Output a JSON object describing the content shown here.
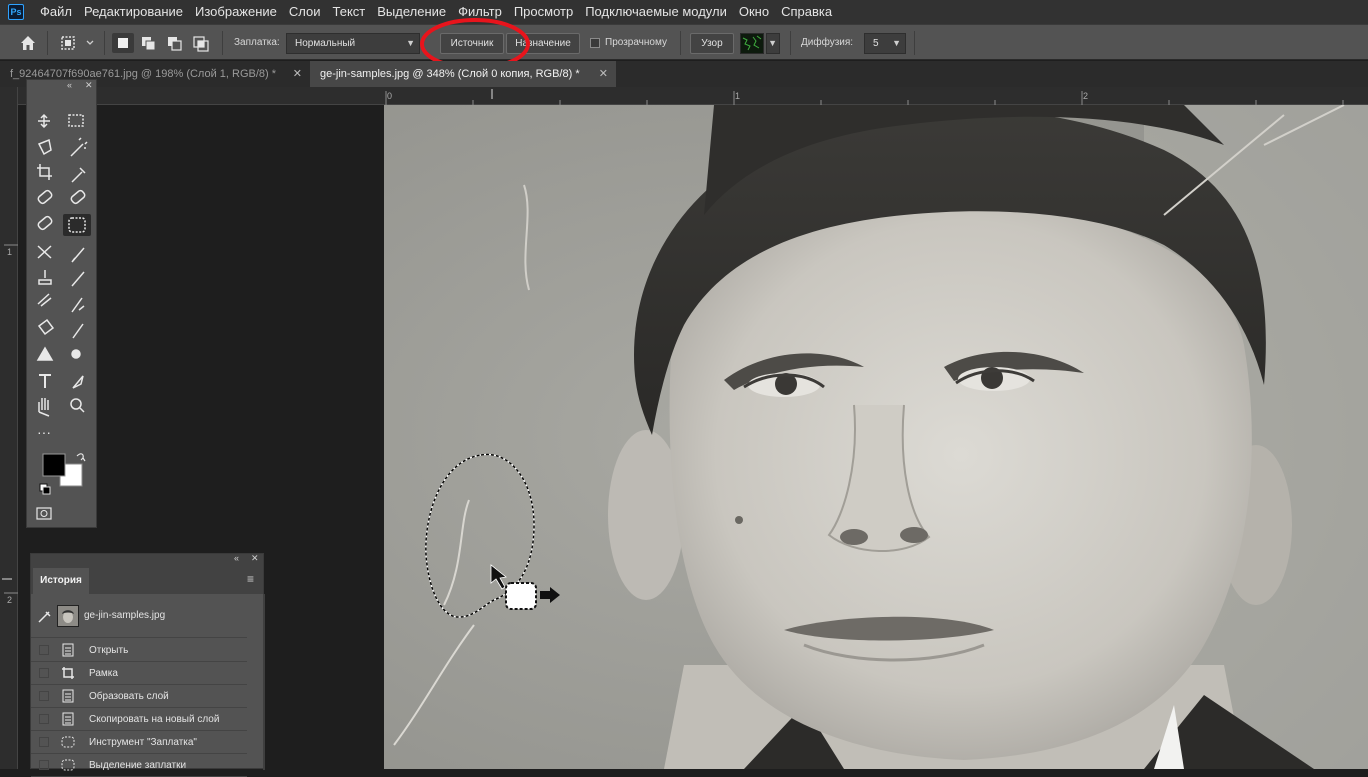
{
  "app": {
    "logo": "Ps"
  },
  "menu": [
    "Файл",
    "Редактирование",
    "Изображение",
    "Слои",
    "Текст",
    "Выделение",
    "Фильтр",
    "Просмотр",
    "Подключаемые модули",
    "Окно",
    "Справка"
  ],
  "options": {
    "patch_label": "Заплатка:",
    "patch_mode": "Нормальный",
    "source_label": "Источник",
    "dest_label": "Назначение",
    "transparent_label": "Прозрачному",
    "pattern_label": "Узор",
    "diffusion_label": "Диффузия:",
    "diffusion_value": "5"
  },
  "tabs": [
    {
      "label": "f_92464707f690ae761.jpg @ 198% (Слой 1, RGB/8) *",
      "active": false
    },
    {
      "label": "ge-jin-samples.jpg @ 348% (Слой 0 копия, RGB/8) *",
      "active": true
    }
  ],
  "ruler": {
    "top": [
      "0",
      "1",
      "2"
    ],
    "left": [
      "1",
      "2"
    ]
  },
  "history": {
    "title": "История",
    "snapshot": "ge-jin-samples.jpg",
    "items": [
      {
        "label": "Открыть",
        "icon": "document-icon"
      },
      {
        "label": "Рамка",
        "icon": "crop-icon"
      },
      {
        "label": "Образовать слой",
        "icon": "document-icon"
      },
      {
        "label": "Скопировать на новый слой",
        "icon": "document-icon"
      },
      {
        "label": "Инструмент \"Заплатка\"",
        "icon": "patch-icon"
      },
      {
        "label": "Выделение заплатки",
        "icon": "patch-icon"
      }
    ]
  },
  "colors": {
    "accent_circle": "#e8141c",
    "foreground": "#000000",
    "background": "#ffffff"
  }
}
